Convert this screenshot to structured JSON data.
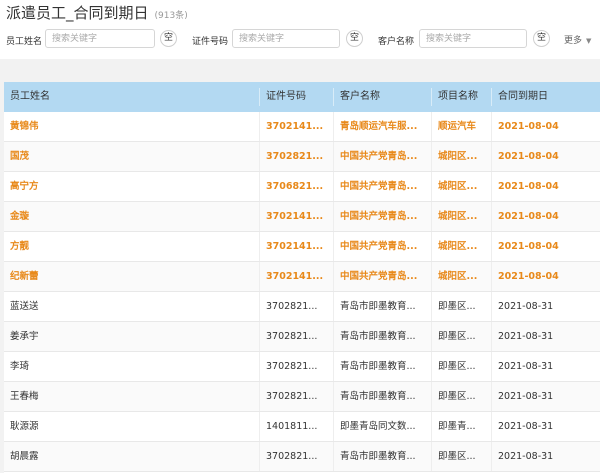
{
  "header": {
    "title": "派遣员工_合同到期日",
    "count": "(913条)"
  },
  "filters": [
    {
      "label": "员工姓名",
      "placeholder": "搜索关键字",
      "clear": "空"
    },
    {
      "label": "证件号码",
      "placeholder": "搜索关键字",
      "clear": "空"
    },
    {
      "label": "客户名称",
      "placeholder": "搜索关键字",
      "clear": "空"
    }
  ],
  "more_label": "更多",
  "table": {
    "columns": [
      "员工姓名",
      "证件号码",
      "客户名称",
      "项目名称",
      "合同到期日"
    ],
    "rows": [
      {
        "name": "黄锦伟",
        "id": "3702141...",
        "customer": "青岛顺运汽车服...",
        "project": "顺运汽车",
        "date": "2021-08-04",
        "highlight": true
      },
      {
        "name": "国茂",
        "id": "3702821...",
        "customer": "中国共产党青岛...",
        "project": "城阳区...",
        "date": "2021-08-04",
        "highlight": true
      },
      {
        "name": "高宁方",
        "id": "3706821...",
        "customer": "中国共产党青岛...",
        "project": "城阳区...",
        "date": "2021-08-04",
        "highlight": true
      },
      {
        "name": "金璇",
        "id": "3702141...",
        "customer": "中国共产党青岛...",
        "project": "城阳区...",
        "date": "2021-08-04",
        "highlight": true
      },
      {
        "name": "方靓",
        "id": "3702141...",
        "customer": "中国共产党青岛...",
        "project": "城阳区...",
        "date": "2021-08-04",
        "highlight": true
      },
      {
        "name": "纪新蕾",
        "id": "3702141...",
        "customer": "中国共产党青岛...",
        "project": "城阳区...",
        "date": "2021-08-04",
        "highlight": true
      },
      {
        "name": "蓝送送",
        "id": "3702821...",
        "customer": "青岛市即墨教育...",
        "project": "即墨区...",
        "date": "2021-08-31",
        "highlight": false
      },
      {
        "name": "姜承宇",
        "id": "3702821...",
        "customer": "青岛市即墨教育...",
        "project": "即墨区...",
        "date": "2021-08-31",
        "highlight": false
      },
      {
        "name": "李琦",
        "id": "3702821...",
        "customer": "青岛市即墨教育...",
        "project": "即墨区...",
        "date": "2021-08-31",
        "highlight": false
      },
      {
        "name": "王春梅",
        "id": "3702821...",
        "customer": "青岛市即墨教育...",
        "project": "即墨区...",
        "date": "2021-08-31",
        "highlight": false
      },
      {
        "name": "耿源源",
        "id": "1401811...",
        "customer": "即墨青岛同文数...",
        "project": "即墨青...",
        "date": "2021-08-31",
        "highlight": false
      },
      {
        "name": "胡晨露",
        "id": "3702821...",
        "customer": "青岛市即墨教育...",
        "project": "即墨区...",
        "date": "2021-08-31",
        "highlight": false
      }
    ]
  },
  "colors": {
    "header_bg": "#b3d9f2",
    "highlight_text": "#e8891a"
  }
}
